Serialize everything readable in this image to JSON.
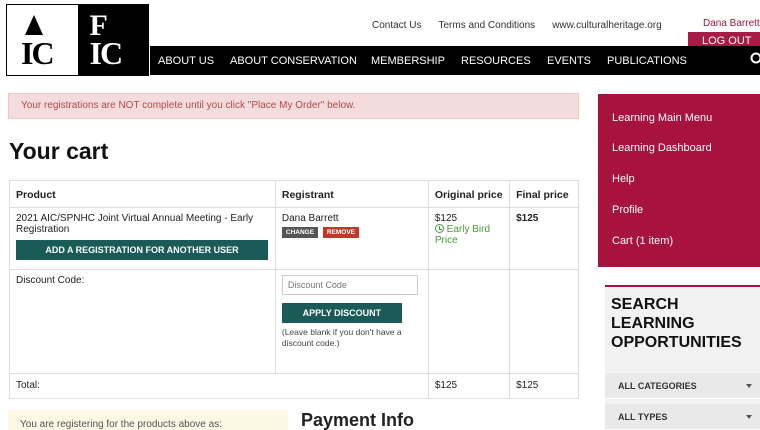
{
  "header": {
    "logo_text": {
      "left": "IC",
      "right_top": "F",
      "right_bottom": "IC"
    },
    "utility_links": [
      "Contact Us",
      "Terms and Conditions",
      "www.culturalheritage.org"
    ],
    "user_name": "Dana Barrett",
    "logout_label": "LOG OUT",
    "nav_items": [
      "ABOUT US",
      "ABOUT CONSERVATION",
      "MEMBERSHIP",
      "RESOURCES",
      "EVENTS",
      "PUBLICATIONS"
    ]
  },
  "alert": "Your registrations are NOT complete until you click \"Place My Order\" below.",
  "page_title": "Your cart",
  "cart": {
    "columns": [
      "Product",
      "Registrant",
      "Original price",
      "Final price"
    ],
    "item": {
      "product": "2021 AIC/SPNHC Joint Virtual Annual Meeting - Early Registration",
      "add_registration_label": "ADD A REGISTRATION FOR ANOTHER USER",
      "registrant": "Dana Barrett",
      "change_label": "CHANGE",
      "remove_label": "REMOVE",
      "original_price": "$125",
      "discount_note": "Early Bird Price",
      "final_price": "$125"
    },
    "discount": {
      "label": "Discount Code:",
      "placeholder": "Discount Code",
      "apply_label": "APPLY DISCOUNT",
      "help": "(Leave blank if you don't have a discount code.)"
    },
    "total": {
      "label": "Total:",
      "original": "$125",
      "final": "$125"
    }
  },
  "registering_as": "You are registering for the products above as:",
  "payment_title": "Payment Info",
  "sidebar": {
    "menu": [
      "Learning Main Menu",
      "Learning Dashboard",
      "Help",
      "Profile",
      "Cart (1 item)"
    ],
    "search_heading": "SEARCH LEARNING OPPORTUNITIES",
    "filters": [
      "ALL CATEGORIES",
      "ALL TYPES"
    ]
  },
  "colors": {
    "brand_crimson": "#a8123e",
    "teal_button": "#1a5b57",
    "alert_bg": "#f4dcdc",
    "early_bird_green": "#4a9b3c"
  }
}
